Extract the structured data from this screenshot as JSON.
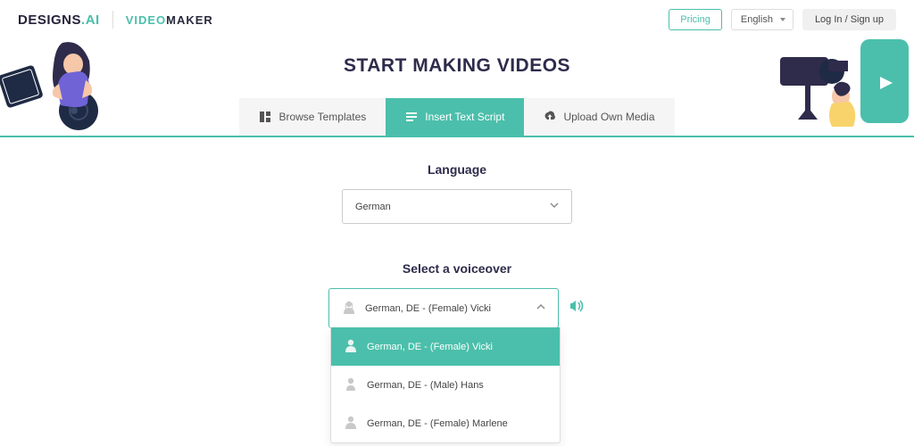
{
  "header": {
    "logo_primary_a": "DESIGNS",
    "logo_primary_b": "AI",
    "logo_secondary_a": "VIDEO",
    "logo_secondary_b": "MAKER",
    "pricing_label": "Pricing",
    "language_selected": "English",
    "login_label": "Log In / Sign up"
  },
  "hero": {
    "title": "START MAKING VIDEOS",
    "tabs": [
      {
        "label": "Browse Templates",
        "active": false
      },
      {
        "label": "Insert Text Script",
        "active": true
      },
      {
        "label": "Upload Own Media",
        "active": false
      }
    ]
  },
  "language_section": {
    "label": "Language",
    "selected": "German"
  },
  "voiceover_section": {
    "label": "Select a voiceover",
    "selected": "German, DE - (Female) Vicki",
    "options": [
      {
        "label": "German, DE - (Female) Vicki",
        "gender": "female",
        "selected": true
      },
      {
        "label": "German, DE - (Male) Hans",
        "gender": "male",
        "selected": false
      },
      {
        "label": "German, DE - (Female) Marlene",
        "gender": "female",
        "selected": false
      }
    ]
  },
  "colors": {
    "accent": "#4bbfab",
    "text_dark": "#2e2b4b"
  }
}
